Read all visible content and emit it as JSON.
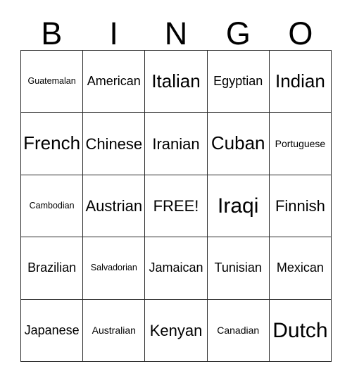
{
  "card": {
    "title": "BINGO",
    "header_letters": [
      "B",
      "I",
      "N",
      "G",
      "O"
    ],
    "free_space_label": "FREE!",
    "free_space_position": {
      "row": 3,
      "column": 3
    },
    "grid_size": "5x5",
    "colors": {
      "background": "#ffffff",
      "border": "#2b2b2b",
      "text": "#000000"
    },
    "rows": [
      [
        {
          "label": "Guatemalan",
          "size": "xxs"
        },
        {
          "label": "American",
          "size": "sm"
        },
        {
          "label": "Italian",
          "size": "lg"
        },
        {
          "label": "Egyptian",
          "size": "sm"
        },
        {
          "label": "Indian",
          "size": "lg"
        }
      ],
      [
        {
          "label": "French",
          "size": "lg"
        },
        {
          "label": "Chinese",
          "size": "md"
        },
        {
          "label": "Iranian",
          "size": "md"
        },
        {
          "label": "Cuban",
          "size": "lg"
        },
        {
          "label": "Portuguese",
          "size": "xs"
        }
      ],
      [
        {
          "label": "Cambodian",
          "size": "xxs"
        },
        {
          "label": "Austrian",
          "size": "md"
        },
        {
          "label": "FREE!",
          "size": "md"
        },
        {
          "label": "Iraqi",
          "size": "xl"
        },
        {
          "label": "Finnish",
          "size": "md"
        }
      ],
      [
        {
          "label": "Brazilian",
          "size": "sm"
        },
        {
          "label": "Salvadorian",
          "size": "xxs"
        },
        {
          "label": "Jamaican",
          "size": "sm"
        },
        {
          "label": "Tunisian",
          "size": "sm"
        },
        {
          "label": "Mexican",
          "size": "sm"
        }
      ],
      [
        {
          "label": "Japanese",
          "size": "sm"
        },
        {
          "label": "Australian",
          "size": "xs"
        },
        {
          "label": "Kenyan",
          "size": "md"
        },
        {
          "label": "Canadian",
          "size": "xs"
        },
        {
          "label": "Dutch",
          "size": "xl"
        }
      ]
    ]
  }
}
